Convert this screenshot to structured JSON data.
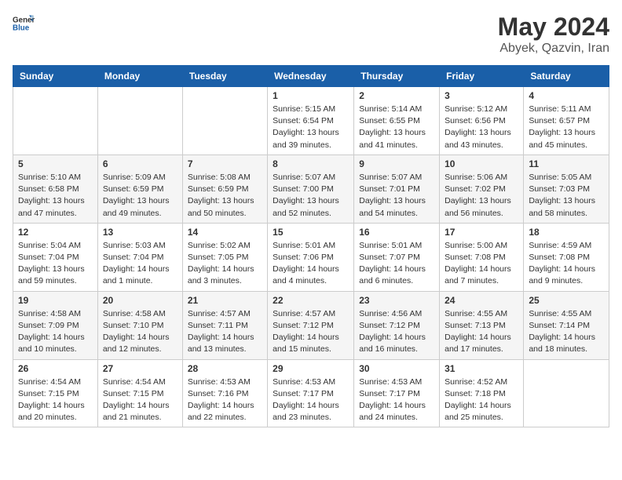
{
  "header": {
    "logo_general": "General",
    "logo_blue": "Blue",
    "title": "May 2024",
    "location": "Abyek, Qazvin, Iran"
  },
  "weekdays": [
    "Sunday",
    "Monday",
    "Tuesday",
    "Wednesday",
    "Thursday",
    "Friday",
    "Saturday"
  ],
  "weeks": [
    [
      {
        "day": "",
        "sunrise": "",
        "sunset": "",
        "daylight": ""
      },
      {
        "day": "",
        "sunrise": "",
        "sunset": "",
        "daylight": ""
      },
      {
        "day": "",
        "sunrise": "",
        "sunset": "",
        "daylight": ""
      },
      {
        "day": "1",
        "sunrise": "Sunrise: 5:15 AM",
        "sunset": "Sunset: 6:54 PM",
        "daylight": "Daylight: 13 hours and 39 minutes."
      },
      {
        "day": "2",
        "sunrise": "Sunrise: 5:14 AM",
        "sunset": "Sunset: 6:55 PM",
        "daylight": "Daylight: 13 hours and 41 minutes."
      },
      {
        "day": "3",
        "sunrise": "Sunrise: 5:12 AM",
        "sunset": "Sunset: 6:56 PM",
        "daylight": "Daylight: 13 hours and 43 minutes."
      },
      {
        "day": "4",
        "sunrise": "Sunrise: 5:11 AM",
        "sunset": "Sunset: 6:57 PM",
        "daylight": "Daylight: 13 hours and 45 minutes."
      }
    ],
    [
      {
        "day": "5",
        "sunrise": "Sunrise: 5:10 AM",
        "sunset": "Sunset: 6:58 PM",
        "daylight": "Daylight: 13 hours and 47 minutes."
      },
      {
        "day": "6",
        "sunrise": "Sunrise: 5:09 AM",
        "sunset": "Sunset: 6:59 PM",
        "daylight": "Daylight: 13 hours and 49 minutes."
      },
      {
        "day": "7",
        "sunrise": "Sunrise: 5:08 AM",
        "sunset": "Sunset: 6:59 PM",
        "daylight": "Daylight: 13 hours and 50 minutes."
      },
      {
        "day": "8",
        "sunrise": "Sunrise: 5:07 AM",
        "sunset": "Sunset: 7:00 PM",
        "daylight": "Daylight: 13 hours and 52 minutes."
      },
      {
        "day": "9",
        "sunrise": "Sunrise: 5:07 AM",
        "sunset": "Sunset: 7:01 PM",
        "daylight": "Daylight: 13 hours and 54 minutes."
      },
      {
        "day": "10",
        "sunrise": "Sunrise: 5:06 AM",
        "sunset": "Sunset: 7:02 PM",
        "daylight": "Daylight: 13 hours and 56 minutes."
      },
      {
        "day": "11",
        "sunrise": "Sunrise: 5:05 AM",
        "sunset": "Sunset: 7:03 PM",
        "daylight": "Daylight: 13 hours and 58 minutes."
      }
    ],
    [
      {
        "day": "12",
        "sunrise": "Sunrise: 5:04 AM",
        "sunset": "Sunset: 7:04 PM",
        "daylight": "Daylight: 13 hours and 59 minutes."
      },
      {
        "day": "13",
        "sunrise": "Sunrise: 5:03 AM",
        "sunset": "Sunset: 7:04 PM",
        "daylight": "Daylight: 14 hours and 1 minute."
      },
      {
        "day": "14",
        "sunrise": "Sunrise: 5:02 AM",
        "sunset": "Sunset: 7:05 PM",
        "daylight": "Daylight: 14 hours and 3 minutes."
      },
      {
        "day": "15",
        "sunrise": "Sunrise: 5:01 AM",
        "sunset": "Sunset: 7:06 PM",
        "daylight": "Daylight: 14 hours and 4 minutes."
      },
      {
        "day": "16",
        "sunrise": "Sunrise: 5:01 AM",
        "sunset": "Sunset: 7:07 PM",
        "daylight": "Daylight: 14 hours and 6 minutes."
      },
      {
        "day": "17",
        "sunrise": "Sunrise: 5:00 AM",
        "sunset": "Sunset: 7:08 PM",
        "daylight": "Daylight: 14 hours and 7 minutes."
      },
      {
        "day": "18",
        "sunrise": "Sunrise: 4:59 AM",
        "sunset": "Sunset: 7:08 PM",
        "daylight": "Daylight: 14 hours and 9 minutes."
      }
    ],
    [
      {
        "day": "19",
        "sunrise": "Sunrise: 4:58 AM",
        "sunset": "Sunset: 7:09 PM",
        "daylight": "Daylight: 14 hours and 10 minutes."
      },
      {
        "day": "20",
        "sunrise": "Sunrise: 4:58 AM",
        "sunset": "Sunset: 7:10 PM",
        "daylight": "Daylight: 14 hours and 12 minutes."
      },
      {
        "day": "21",
        "sunrise": "Sunrise: 4:57 AM",
        "sunset": "Sunset: 7:11 PM",
        "daylight": "Daylight: 14 hours and 13 minutes."
      },
      {
        "day": "22",
        "sunrise": "Sunrise: 4:57 AM",
        "sunset": "Sunset: 7:12 PM",
        "daylight": "Daylight: 14 hours and 15 minutes."
      },
      {
        "day": "23",
        "sunrise": "Sunrise: 4:56 AM",
        "sunset": "Sunset: 7:12 PM",
        "daylight": "Daylight: 14 hours and 16 minutes."
      },
      {
        "day": "24",
        "sunrise": "Sunrise: 4:55 AM",
        "sunset": "Sunset: 7:13 PM",
        "daylight": "Daylight: 14 hours and 17 minutes."
      },
      {
        "day": "25",
        "sunrise": "Sunrise: 4:55 AM",
        "sunset": "Sunset: 7:14 PM",
        "daylight": "Daylight: 14 hours and 18 minutes."
      }
    ],
    [
      {
        "day": "26",
        "sunrise": "Sunrise: 4:54 AM",
        "sunset": "Sunset: 7:15 PM",
        "daylight": "Daylight: 14 hours and 20 minutes."
      },
      {
        "day": "27",
        "sunrise": "Sunrise: 4:54 AM",
        "sunset": "Sunset: 7:15 PM",
        "daylight": "Daylight: 14 hours and 21 minutes."
      },
      {
        "day": "28",
        "sunrise": "Sunrise: 4:53 AM",
        "sunset": "Sunset: 7:16 PM",
        "daylight": "Daylight: 14 hours and 22 minutes."
      },
      {
        "day": "29",
        "sunrise": "Sunrise: 4:53 AM",
        "sunset": "Sunset: 7:17 PM",
        "daylight": "Daylight: 14 hours and 23 minutes."
      },
      {
        "day": "30",
        "sunrise": "Sunrise: 4:53 AM",
        "sunset": "Sunset: 7:17 PM",
        "daylight": "Daylight: 14 hours and 24 minutes."
      },
      {
        "day": "31",
        "sunrise": "Sunrise: 4:52 AM",
        "sunset": "Sunset: 7:18 PM",
        "daylight": "Daylight: 14 hours and 25 minutes."
      },
      {
        "day": "",
        "sunrise": "",
        "sunset": "",
        "daylight": ""
      }
    ]
  ]
}
